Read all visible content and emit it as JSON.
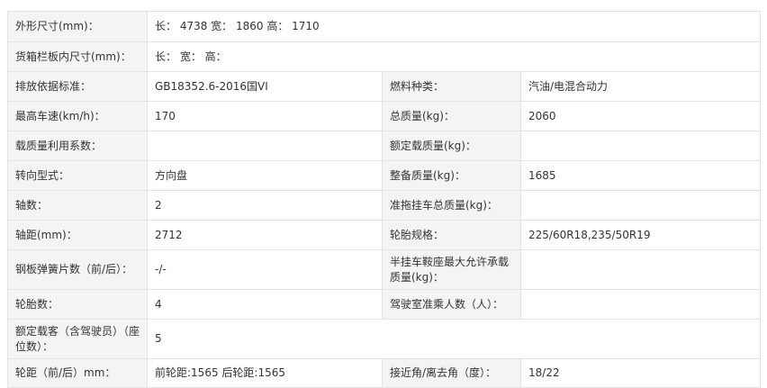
{
  "rows": [
    {
      "label": "外形尺寸(mm)：",
      "value": "长： 4738 宽： 1860 高： 1710",
      "full": true
    },
    {
      "label": "货箱栏板内尺寸(mm)：",
      "value": "长：  宽：  高：",
      "full": true
    },
    {
      "label": "排放依据标准：",
      "value": "GB18352.6-2016国VI",
      "label2": "燃料种类：",
      "value2": "汽油/电混合动力"
    },
    {
      "label": "最高车速(km/h)：",
      "value": "170",
      "label2": "总质量(kg)：",
      "value2": "2060"
    },
    {
      "label": "载质量利用系数：",
      "value": "",
      "label2": "额定载质量(kg)：",
      "value2": ""
    },
    {
      "label": "转向型式：",
      "value": "方向盘",
      "label2": "整备质量(kg)：",
      "value2": "1685"
    },
    {
      "label": "轴数：",
      "value": "2",
      "label2": "准拖挂车总质量(kg)：",
      "value2": ""
    },
    {
      "label": "轴距(mm)：",
      "value": "2712",
      "label2": "轮胎规格：",
      "value2": "225/60R18,235/50R19"
    },
    {
      "label": "钢板弹簧片数（前/后）：",
      "value": "-/-",
      "label2": "半挂车鞍座最大允许承载质量(kg)：",
      "value2": ""
    },
    {
      "label": "轮胎数：",
      "value": "4",
      "label2": "驾驶室准乘人数（人）：",
      "value2": ""
    },
    {
      "label": "额定载客（含驾驶员）（座位数）：",
      "value": "5",
      "full": true
    },
    {
      "label": "轮距（前/后）mm：",
      "value": "前轮距:1565 后轮距:1565",
      "label2": "接近角/离去角（度）：",
      "value2": "18/22"
    }
  ]
}
